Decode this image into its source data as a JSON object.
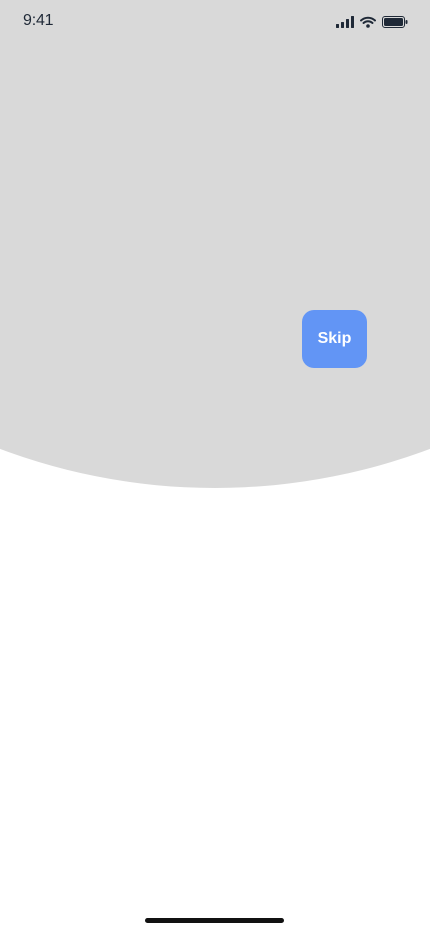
{
  "status_bar": {
    "time": "9:41",
    "icons": [
      "signal-icon",
      "wifi-icon",
      "battery-icon"
    ]
  },
  "onboarding": {
    "skip_label": "Skip"
  },
  "colors": {
    "hero_background": "#d9d9d9",
    "skip_button": "#6295f5",
    "status_text": "#1f2937"
  }
}
